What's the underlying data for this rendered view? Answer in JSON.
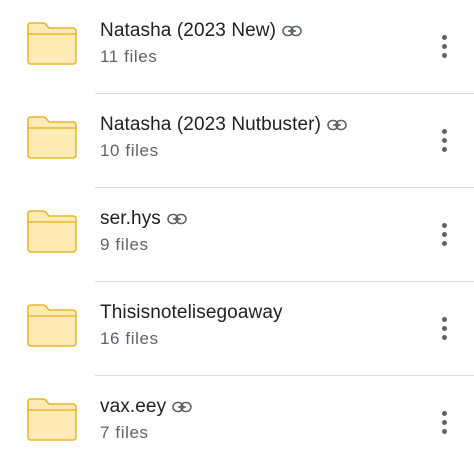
{
  "folders": [
    {
      "name": "Natasha (2023 New)",
      "count": "11 files",
      "shared": true
    },
    {
      "name": "Natasha (2023 Nutbuster)",
      "count": "10 files",
      "shared": true
    },
    {
      "name": "ser.hys",
      "count": "9 files",
      "shared": true
    },
    {
      "name": "Thisisnotelisegoaway",
      "count": "16 files",
      "shared": false
    },
    {
      "name": "vax.eey",
      "count": "7 files",
      "shared": true
    }
  ],
  "icons": {
    "folder": "folder-icon",
    "link": "link-icon",
    "more": "more-vert-icon"
  },
  "colors": {
    "folder_fill": "#fdebb3",
    "folder_stroke": "#e7b731"
  }
}
